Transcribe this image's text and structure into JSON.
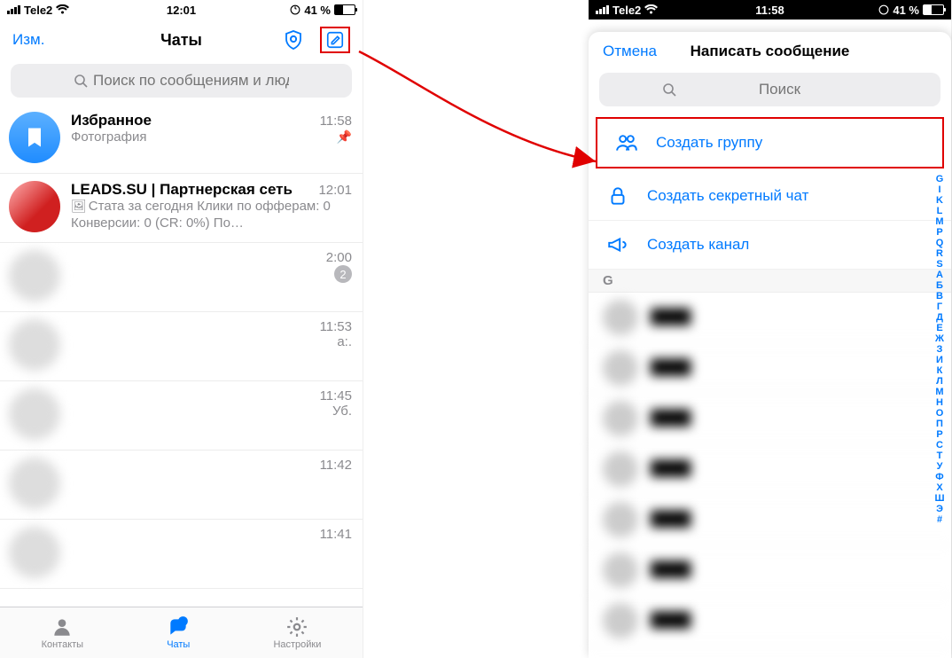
{
  "left": {
    "status": {
      "carrier": "Tele2",
      "time": "12:01",
      "battery_text": "41 %",
      "battery_pct": 41
    },
    "nav": {
      "edit": "Изм.",
      "title": "Чаты"
    },
    "search": {
      "placeholder": "Поиск по сообщениям и людям"
    },
    "chats": [
      {
        "name": "Избранное",
        "sub": "Фотография",
        "time": "11:58",
        "pinned": true
      },
      {
        "name": "LEADS.SU | Партнерская сеть",
        "sub": "Стата за сегодня Клики по офферам: 0 Конверсии: 0 (CR: 0%) По…",
        "time": "12:01"
      },
      {
        "name": " ",
        "sub": " ",
        "time": "2:00",
        "badge": "2"
      },
      {
        "name": " ",
        "sub": " ",
        "time": "11:53",
        "trailing": "а:."
      },
      {
        "name": " ",
        "sub": " ",
        "time": "11:45",
        "trailing": "Уб."
      },
      {
        "name": " ",
        "sub": " ",
        "time": "11:42"
      },
      {
        "name": " ",
        "sub": " ",
        "time": "11:41"
      }
    ],
    "tabs": {
      "contacts": "Контакты",
      "chats": "Чаты",
      "settings": "Настройки"
    }
  },
  "right": {
    "status": {
      "carrier": "Tele2",
      "time": "11:58",
      "battery_text": "41 %",
      "battery_pct": 41
    },
    "modal": {
      "cancel": "Отмена",
      "title": "Написать сообщение",
      "search_placeholder": "Поиск",
      "actions": {
        "group": "Создать группу",
        "secret": "Создать секретный чат",
        "channel": "Создать канал"
      },
      "section": "G",
      "index": [
        "G",
        "I",
        "K",
        "L",
        "M",
        "P",
        "Q",
        "R",
        "S",
        "А",
        "Б",
        "В",
        "Г",
        "Д",
        "Е",
        "Ж",
        "З",
        "И",
        "К",
        "Л",
        "М",
        "Н",
        "О",
        "П",
        "Р",
        "С",
        "Т",
        "У",
        "Ф",
        "Х",
        "Ш",
        "Э",
        "#"
      ]
    }
  }
}
